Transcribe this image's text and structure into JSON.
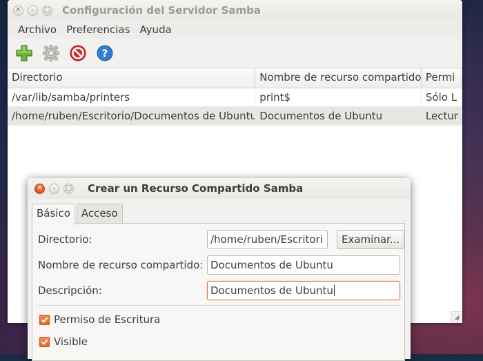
{
  "main_window": {
    "title": "Configuración del Servidor Samba",
    "menu": [
      "Archivo",
      "Preferencias",
      "Ayuda"
    ],
    "toolbar": {
      "icons": [
        "add-icon",
        "gear-icon",
        "delete-icon",
        "help-icon"
      ]
    },
    "table": {
      "columns": [
        "Directorio",
        "Nombre de recurso compartido",
        "Permi"
      ],
      "rows": [
        {
          "directorio": "/var/lib/samba/printers",
          "nombre": "print$",
          "permisos": "Sólo L"
        },
        {
          "directorio": "/home/ruben/Escritorio/Documentos de Ubuntu",
          "nombre": "Documentos de Ubuntu",
          "permisos": "Lectur"
        }
      ],
      "selected_row": 1
    }
  },
  "dialog": {
    "title": "Crear un Recurso Compartido Samba",
    "tabs": [
      "Básico",
      "Acceso"
    ],
    "active_tab": "Básico",
    "fields": {
      "directorio_label": "Directorio:",
      "directorio_value": "/home/ruben/Escritori",
      "examinar_label": "Examinar...",
      "nombre_label": "Nombre de recurso compartido:",
      "nombre_value": "Documentos de Ubuntu",
      "descripcion_label": "Descripción:",
      "descripcion_value": "Documentos de Ubuntu"
    },
    "checkboxes": [
      {
        "label": "Permiso de Escritura",
        "checked": true
      },
      {
        "label": "Visible",
        "checked": true
      }
    ]
  },
  "colors": {
    "accent": "#e06a30",
    "selected_row": "#e7e6e2"
  }
}
